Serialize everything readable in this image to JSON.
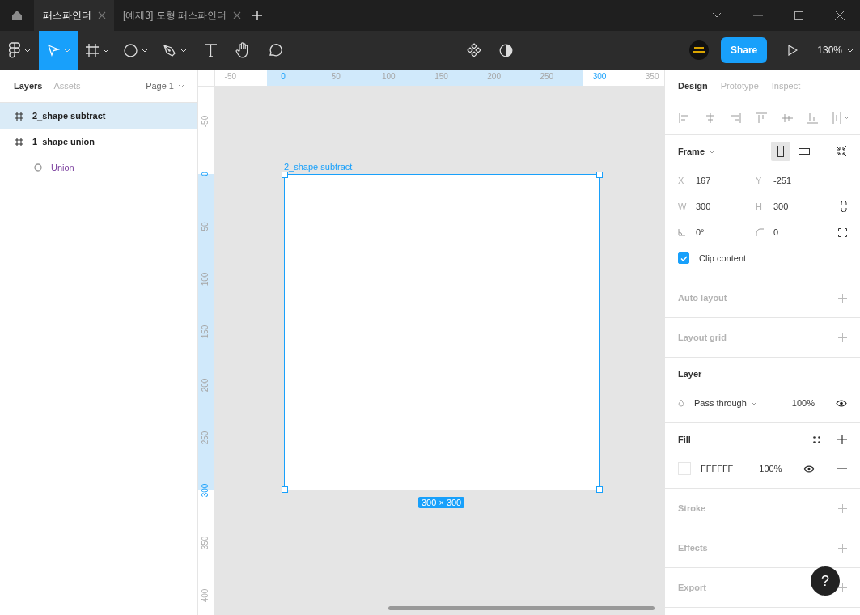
{
  "tabs": [
    {
      "label": "패스파인더",
      "selected": true
    },
    {
      "label": "[예제3] 도형 패스파인더",
      "selected": false
    }
  ],
  "toolbar": {
    "tools": [
      {
        "kind": "menu",
        "selected": false,
        "has_menu": true
      },
      {
        "kind": "move",
        "selected": true,
        "has_menu": true
      },
      {
        "kind": "frame",
        "selected": false,
        "has_menu": true
      },
      {
        "kind": "ellipse",
        "selected": false,
        "has_menu": true
      },
      {
        "kind": "pen",
        "selected": false,
        "has_menu": true
      },
      {
        "kind": "text",
        "selected": false,
        "has_menu": false
      },
      {
        "kind": "hand",
        "selected": false,
        "has_menu": false
      },
      {
        "kind": "comment",
        "selected": false,
        "has_menu": false
      }
    ],
    "share": "Share",
    "zoom": "130%"
  },
  "layers_panel": {
    "tabs": [
      {
        "label": "Layers",
        "selected": true
      },
      {
        "label": "Assets",
        "selected": false
      }
    ],
    "page": "Page 1",
    "layers": [
      {
        "name": "2_shape subtract",
        "kind": "frame",
        "selected": true
      },
      {
        "name": "1_shape union",
        "kind": "frame",
        "selected": false,
        "children": [
          {
            "name": "Union",
            "kind": "boolean",
            "selected": false
          }
        ]
      }
    ]
  },
  "canvas": {
    "frame_name": "2_shape subtract",
    "size_badge": "300 × 300",
    "ruler_x": [
      {
        "label": "-50",
        "kind": "outside"
      },
      {
        "label": "0",
        "kind": "bound"
      },
      {
        "label": "50",
        "kind": "inside"
      },
      {
        "label": "100",
        "kind": "inside"
      },
      {
        "label": "150",
        "kind": "inside"
      },
      {
        "label": "200",
        "kind": "inside"
      },
      {
        "label": "250",
        "kind": "inside"
      },
      {
        "label": "300",
        "kind": "bound"
      },
      {
        "label": "350",
        "kind": "outside"
      }
    ],
    "ruler_y": [
      {
        "label": "-50",
        "kind": "outside"
      },
      {
        "label": "0",
        "kind": "bound"
      },
      {
        "label": "50",
        "kind": "inside"
      },
      {
        "label": "100",
        "kind": "inside"
      },
      {
        "label": "150",
        "kind": "inside"
      },
      {
        "label": "200",
        "kind": "inside"
      },
      {
        "label": "250",
        "kind": "inside"
      },
      {
        "label": "300",
        "kind": "bound"
      },
      {
        "label": "350",
        "kind": "outside"
      },
      {
        "label": "400",
        "kind": "outside"
      }
    ]
  },
  "design_panel": {
    "tabs": [
      {
        "label": "Design",
        "selected": true
      },
      {
        "label": "Prototype",
        "selected": false
      },
      {
        "label": "Inspect",
        "selected": false
      }
    ],
    "frame": {
      "title": "Frame",
      "portrait": true,
      "fields": [
        {
          "label": "X",
          "value": "167"
        },
        {
          "label": "Y",
          "value": "-251"
        },
        {
          "label": "W",
          "value": "300"
        },
        {
          "label": "H",
          "value": "300"
        },
        {
          "kind": "rotation",
          "value": "0°"
        },
        {
          "kind": "radius",
          "value": "0"
        }
      ],
      "clip_content": {
        "label": "Clip content",
        "checked": true
      }
    },
    "sections": [
      {
        "title": "Auto layout",
        "empty": true
      },
      {
        "title": "Layout grid",
        "empty": true
      }
    ],
    "layer": {
      "title": "Layer",
      "blend": "Pass through",
      "opacity": "100%"
    },
    "fill": {
      "title": "Fill",
      "color": "#ffffff",
      "hex": "FFFFFF",
      "opacity": "100%"
    },
    "bottom_sections": [
      {
        "title": "Stroke",
        "empty": true
      },
      {
        "title": "Effects",
        "empty": true
      },
      {
        "title": "Export",
        "empty": true
      }
    ]
  },
  "help": "?"
}
